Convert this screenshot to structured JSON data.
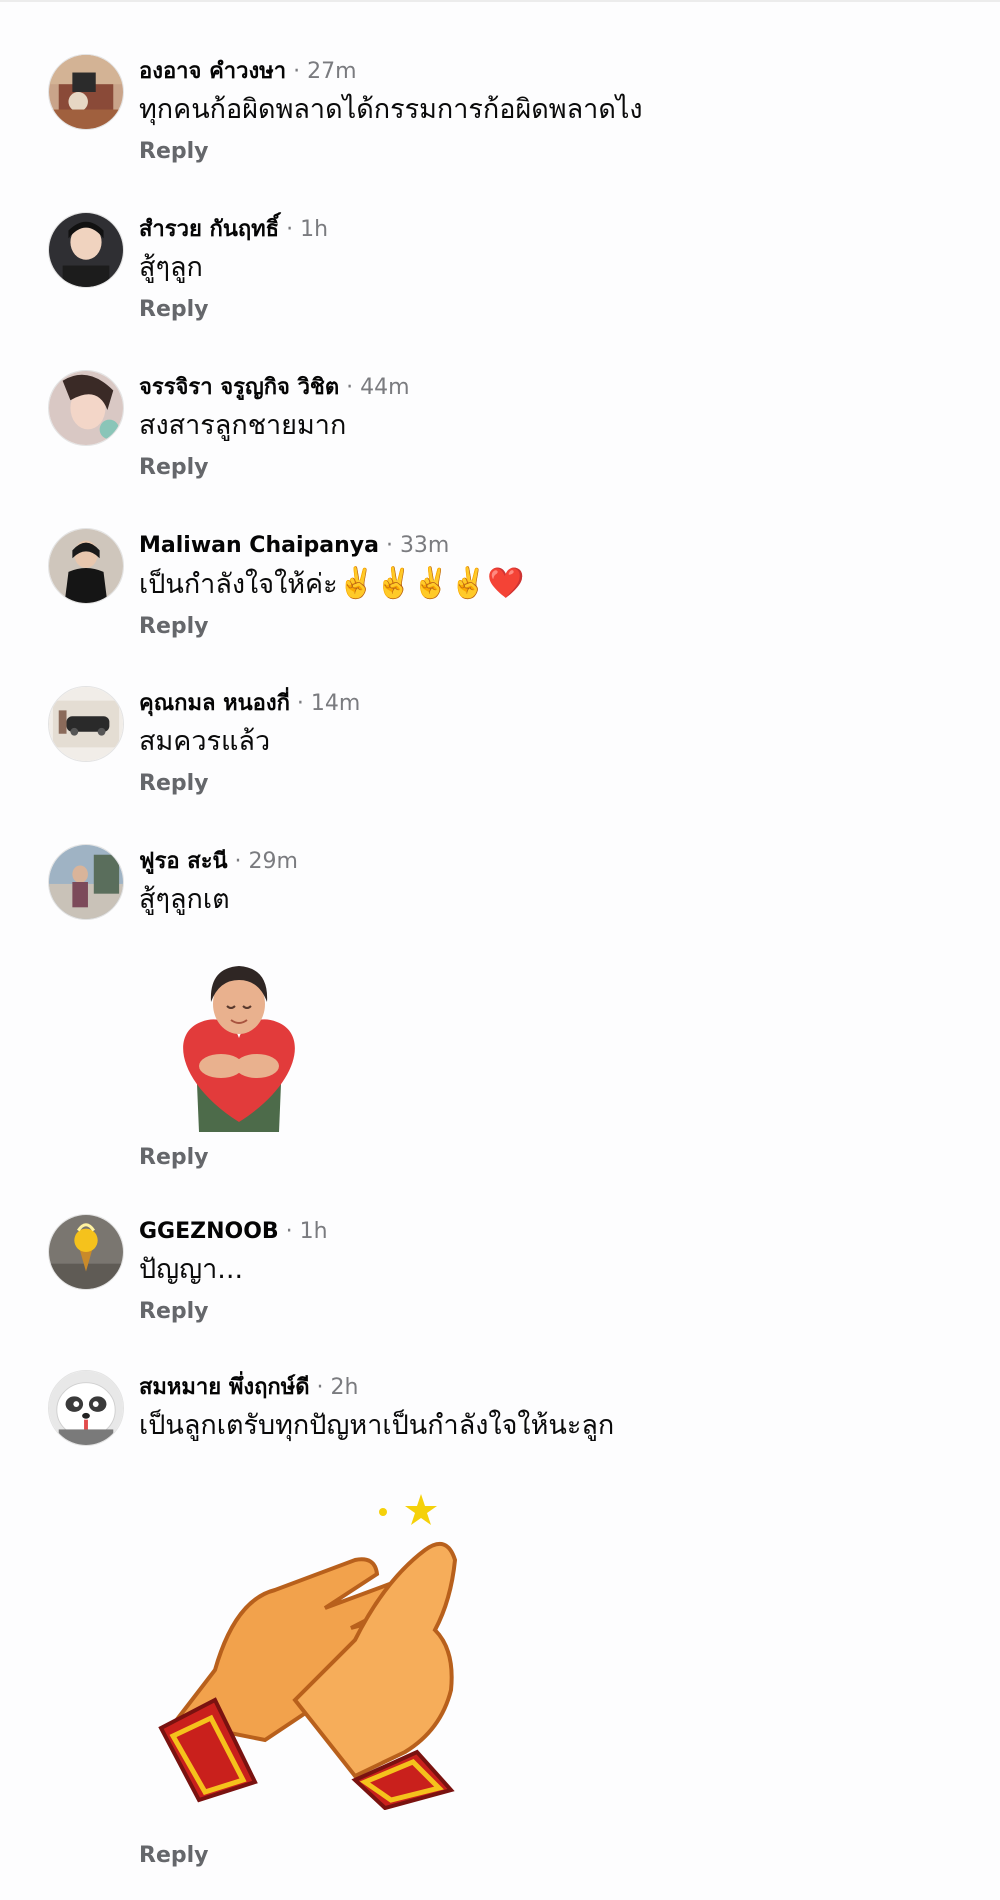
{
  "comments": [
    {
      "name": "องอาจ คำวงษา",
      "sep": " · ",
      "time": "27m",
      "text": "ทุกคนก้อผิดพลาดได้กรรมการก้อผิดพลาดไง",
      "reply": "Reply",
      "avatar_icon": "photo-avatar"
    },
    {
      "name": "สำรวย กันฤทธิ์",
      "sep": " · ",
      "time": "1h",
      "text": "สู้ๆลูก",
      "reply": "Reply",
      "avatar_icon": "photo-avatar"
    },
    {
      "name": "จรรจิรา จรูญกิจ วิชิต",
      "sep": " · ",
      "time": "44m",
      "text": "สงสารลูกชายมาก",
      "reply": "Reply",
      "avatar_icon": "photo-avatar"
    },
    {
      "name": "Maliwan Chaipanya",
      "sep": " · ",
      "time": "33m",
      "text": "เป็นกำลังใจให้ค่ะ",
      "emojis": "✌️✌️✌️✌️❤️",
      "reply": "Reply",
      "avatar_icon": "photo-avatar"
    },
    {
      "name": "คุณกมล หนองกี่",
      "sep": " · ",
      "time": "14m",
      "text": "สมควรแล้ว",
      "reply": "Reply",
      "avatar_icon": "photo-avatar"
    },
    {
      "name": "ฟูรอ สะนี",
      "sep": " · ",
      "time": "29m",
      "text": "สู้ๆลูกเต",
      "reply": "Reply",
      "avatar_icon": "photo-avatar",
      "sticker": "heart-hug-avatar-sticker"
    },
    {
      "name": "GGEZNOOB",
      "sep": " · ",
      "time": "1h",
      "text": "ปัญญา...",
      "reply": "Reply",
      "avatar_icon": "photo-avatar"
    },
    {
      "name": "สมหมาย พึ่งฤกษ์ดี",
      "sep": " · ",
      "time": "2h",
      "text": "เป็นลูกเตรับทุกปัญหาเป็นกำลังใจให้นะลูก",
      "reply": "Reply",
      "avatar_icon": "panda-avatar",
      "sticker": "clapping-hands-sticker"
    }
  ],
  "colors": {
    "name": "#050505",
    "time": "#7a7b7f",
    "reply": "#65676b",
    "background": "#fdfdfe"
  }
}
